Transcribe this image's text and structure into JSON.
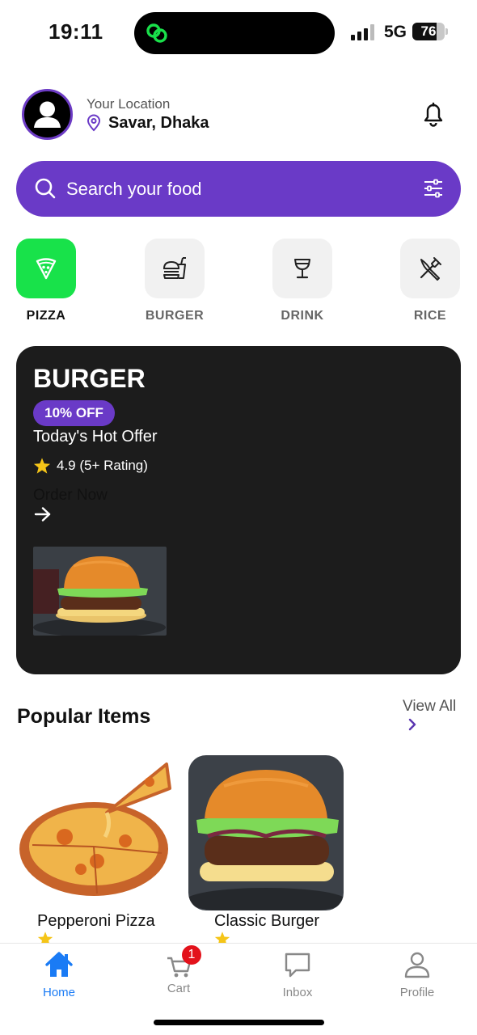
{
  "status_bar": {
    "time": "19:11",
    "network": "5G",
    "battery": "76",
    "battery_level": 0.76
  },
  "header": {
    "location_label": "Your Location",
    "location_value": "Savar, Dhaka",
    "icons": {
      "avatar": "user-avatar-icon",
      "pin": "map-pin-icon",
      "notification": "bell-icon"
    }
  },
  "search": {
    "placeholder": "Search your food",
    "icons": {
      "left": "search-icon",
      "right": "filter-sliders-icon"
    }
  },
  "categories": [
    {
      "label": "PIZZA",
      "icon": "pizza-slice-icon",
      "active": true
    },
    {
      "label": "BURGER",
      "icon": "burger-drink-icon",
      "active": false
    },
    {
      "label": "DRINK",
      "icon": "wine-glass-icon",
      "active": false
    },
    {
      "label": "RICE",
      "icon": "fork-knife-icon",
      "active": false
    }
  ],
  "promo": {
    "title": "BURGER",
    "badge": "10% OFF",
    "subtitle": "Today's Hot Offer",
    "rating": "4.9 (5+ Rating)",
    "cta": "Order Now",
    "image": "burger-photo"
  },
  "popular": {
    "title": "Popular Items",
    "view_all": "View All",
    "items": [
      {
        "name": "Pepperoni Pizza",
        "image": "pizza-photo"
      },
      {
        "name": "Classic Burger",
        "image": "burger-photo"
      }
    ]
  },
  "tab_bar": {
    "tabs": [
      {
        "label": "Home",
        "icon": "home-icon",
        "active": true
      },
      {
        "label": "Cart",
        "icon": "cart-icon",
        "active": false,
        "badge": "1"
      },
      {
        "label": "Inbox",
        "icon": "chat-bubble-icon",
        "active": false
      },
      {
        "label": "Profile",
        "icon": "person-icon",
        "active": false
      }
    ]
  },
  "colors": {
    "accent": "#6a3ac7",
    "active_category": "#18e24a",
    "promo_bg": "#1c1c1c",
    "tab_active": "#1a7bf5",
    "badge": "#e3121b",
    "star": "#f5c518"
  }
}
